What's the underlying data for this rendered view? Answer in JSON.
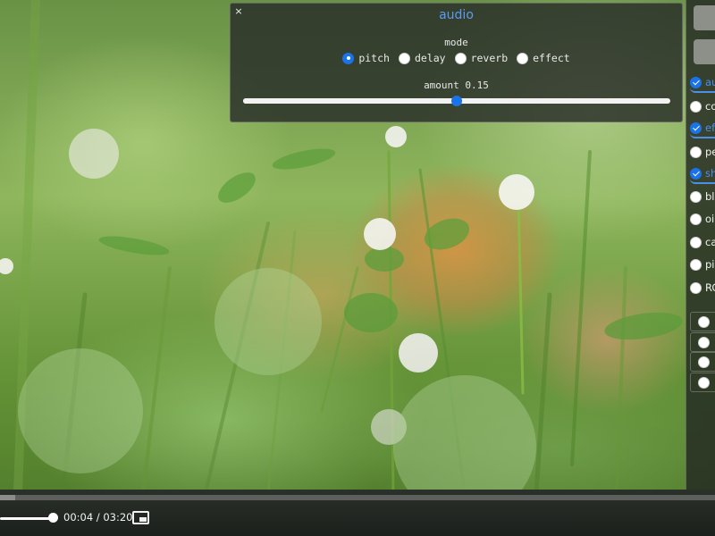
{
  "audio_panel": {
    "close_glyph": "×",
    "title": "audio",
    "mode_label": "mode",
    "modes": [
      {
        "label": "pitch",
        "selected": true
      },
      {
        "label": "delay",
        "selected": false
      },
      {
        "label": "reverb",
        "selected": false
      },
      {
        "label": "effect",
        "selected": false
      }
    ],
    "amount_label": "amount 0.15",
    "amount_value": 0.5
  },
  "filter_panel": {
    "items": [
      {
        "label": "au",
        "checked": true,
        "selected": true
      },
      {
        "label": "co",
        "checked": false,
        "selected": false
      },
      {
        "label": "ef",
        "checked": true,
        "selected": true
      },
      {
        "label": "pe",
        "checked": false,
        "selected": false
      },
      {
        "label": "sh",
        "checked": true,
        "selected": true
      },
      {
        "label": "bl",
        "checked": false,
        "selected": false
      },
      {
        "label": "oi",
        "checked": false,
        "selected": false
      },
      {
        "label": "ca",
        "checked": false,
        "selected": false
      },
      {
        "label": "pi",
        "checked": false,
        "selected": false
      },
      {
        "label": "RC",
        "checked": false,
        "selected": false
      }
    ],
    "extra_rows": 4
  },
  "player": {
    "progress": 0.021,
    "time": "00:04 / 03:20",
    "volume": 0.9
  },
  "colors": {
    "accent": "#1a73e8",
    "title": "#5b9bf0"
  }
}
